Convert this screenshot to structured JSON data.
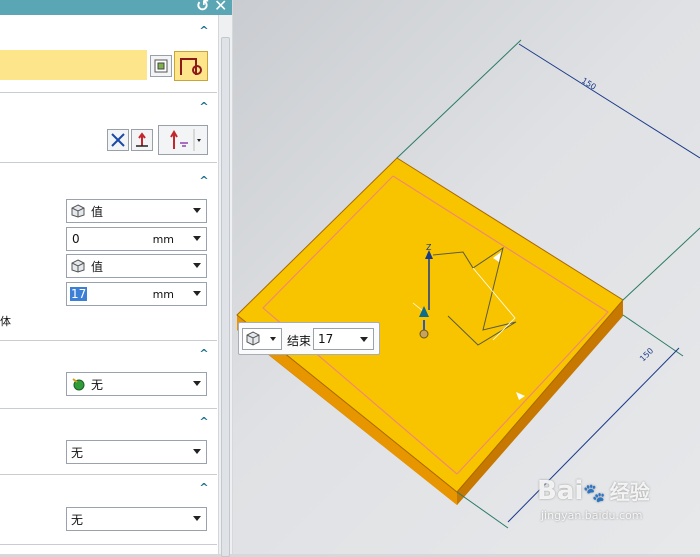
{
  "dialog": {
    "title_buttons": [
      "↺",
      "✕"
    ],
    "section_toggle": "^",
    "start": {
      "type_value": "值",
      "distance": "0",
      "unit": "mm"
    },
    "end": {
      "type_value": "值",
      "distance": "17",
      "unit": "mm"
    },
    "partial_label": "体",
    "boolean": {
      "value": "无"
    },
    "draft": {
      "value": "无"
    },
    "offset": {
      "value": "无"
    }
  },
  "floating_toolbar": {
    "label": "结束",
    "value": "17"
  },
  "viewport": {
    "dim_top": "150",
    "dim_right": "150",
    "axis_label": "Z"
  },
  "watermark": {
    "brand": "Bai",
    "brand2": "经验",
    "url": "jingyan.baidu.com"
  },
  "colors": {
    "accent": "#5aa6b5",
    "highlight": "#fde58c",
    "part": "#f8c400"
  }
}
